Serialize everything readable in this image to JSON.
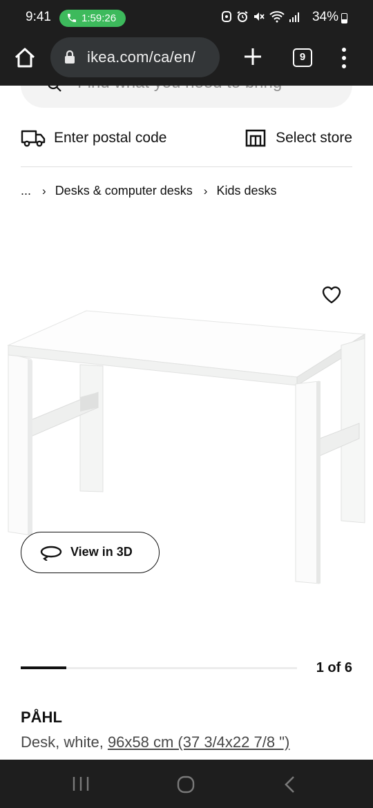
{
  "status_bar": {
    "time": "9:41",
    "call_timer": "1:59:26",
    "battery": "34%",
    "icons": [
      "phone-icon",
      "alarm-icon",
      "mute-icon",
      "wifi-icon",
      "signal-icon",
      "battery-icon"
    ]
  },
  "browser": {
    "url": "ikea.com/ca/en/",
    "tab_count": "9"
  },
  "search": {
    "placeholder": "Find what you need to bring"
  },
  "location": {
    "postal_label": "Enter postal code",
    "store_label": "Select store"
  },
  "breadcrumb": {
    "ellipsis": "...",
    "items": [
      "Desks & computer desks",
      "Kids desks"
    ]
  },
  "product": {
    "view3d_label": "View in 3D",
    "image_progress": 0.166,
    "page_counter": "1 of 6",
    "name": "PÅHL",
    "description_prefix": "Desk, white, ",
    "dimensions": "96x58 cm (37 3/4x22 7/8 \")"
  },
  "colors": {
    "accent_call": "#3dba5c",
    "system_bar": "#1e1e1e",
    "text": "#111111",
    "muted_text": "#484848"
  }
}
